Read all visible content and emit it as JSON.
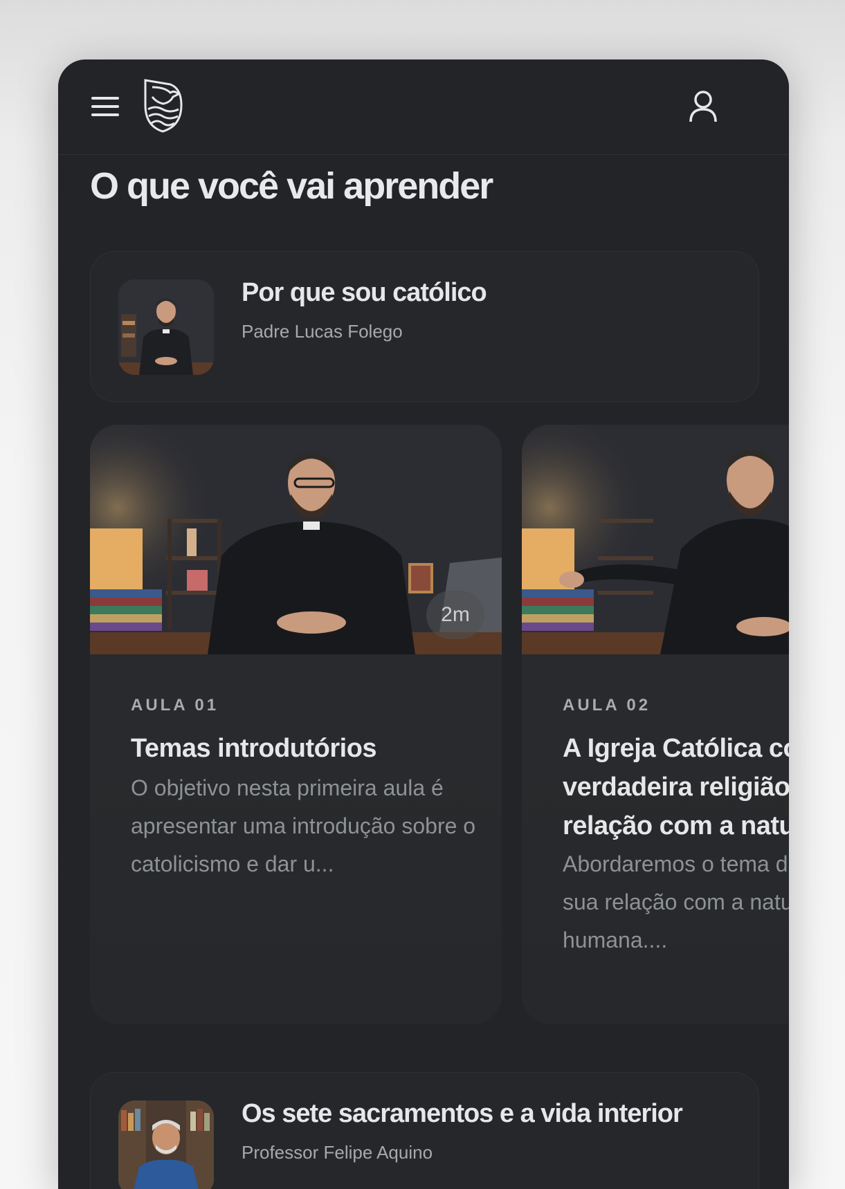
{
  "header": {
    "menu_icon": "hamburger-menu-icon",
    "logo": "shield-bird-waves-logo",
    "profile_icon": "user-icon"
  },
  "section": {
    "title": "O que você vai aprender"
  },
  "courses": [
    {
      "title": "Por que sou católico",
      "author": "Padre Lucas Folego"
    },
    {
      "title": "Os sete sacramentos e a vida interior",
      "author": "Professor Felipe Aquino"
    }
  ],
  "lessons": [
    {
      "label": "AULA 01",
      "title": "Temas introdutórios",
      "description": "O objetivo nesta primeira aula é apresentar uma introdução sobre o catolicismo e dar u...",
      "duration": "2m"
    },
    {
      "label": "AULA 02",
      "title": "A Igreja Católica como verdadeira religião e sua relação com a natureza humana",
      "description": "Abordaremos o tema da religião e sua relação com a natureza humana...."
    }
  ],
  "colors": {
    "background": "#222427",
    "card": "#2a2c2f",
    "text_primary": "#e6e7e8",
    "text_secondary": "#8f9295"
  }
}
